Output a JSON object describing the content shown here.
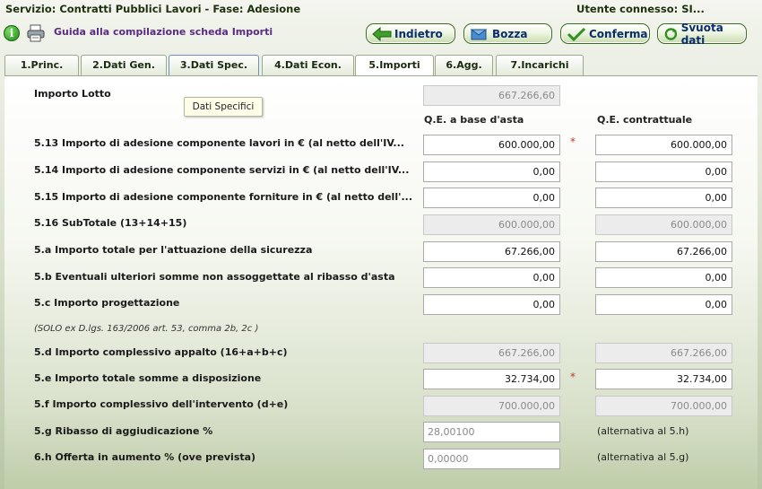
{
  "header": {
    "service": "Servizio: Contratti Pubblici Lavori - Fase: Adesione",
    "user": "Utente connesso: SI..."
  },
  "toolbar": {
    "guide": "Guida alla compilazione scheda Importi",
    "back": "Indietro",
    "draft": "Bozza",
    "confirm": "Conferma",
    "clear": "Svuota dati"
  },
  "tabs": [
    "1.Princ.",
    "2.Dati Gen.",
    "3.Dati Spec.",
    "4.Dati Econ.",
    "5.Importi",
    "6.Agg.",
    "7.Incarichi"
  ],
  "active_tab": "5.Importi",
  "tooltip": "Dati Specifici",
  "columns": {
    "base": "Q.E. a base d'asta",
    "contract": "Q.E. contrattuale"
  },
  "lotto": {
    "label": "Importo Lotto",
    "value": "667.266,60"
  },
  "rows": [
    {
      "label": "5.13 Importo di adesione componente lavori in € (al netto dell'IV...",
      "base": "600.000,00",
      "contract": "600.000,00",
      "required": "*"
    },
    {
      "label": "5.14 Importo di adesione componente servizi in € (al netto dell'IV...",
      "base": "0,00",
      "contract": "0,00"
    },
    {
      "label": "5.15 Importo di adesione componente forniture in € (al netto dell'...",
      "base": "0,00",
      "contract": "0,00"
    },
    {
      "label": "5.16 SubTotale (13+14+15)",
      "base": "600.000,00",
      "contract": "600.000,00"
    },
    {
      "label": "5.a Importo totale per l'attuazione della sicurezza",
      "base": "67.266,00",
      "contract": "67.266,00"
    },
    {
      "label": "5.b Eventuali ulteriori somme non assoggettate al ribasso d'asta",
      "base": "0,00",
      "contract": "0,00"
    },
    {
      "label": "5.c Importo progettazione",
      "base": "0,00",
      "contract": "0,00"
    },
    {
      "label": "5.d Importo complessivo appalto (16+a+b+c)",
      "base": "667.266,00",
      "contract": "667.266,00"
    },
    {
      "label": "5.e Importo totale somme a disposizione",
      "base": "32.734,00",
      "contract": "32.734,00",
      "required": "*"
    },
    {
      "label": "5.f Importo complessivo dell'intervento (d+e)",
      "base": "700.000,00",
      "contract": "700.000,00"
    }
  ],
  "note": "(SOLO ex D.lgs. 163/2006 art. 53, comma 2b, 2c )",
  "ribasso": {
    "label": "5.g Ribasso di aggiudicazione %",
    "value": "28,00100",
    "alt": "(alternativa al 5.h)"
  },
  "offerta": {
    "label": "6.h Offerta in aumento % (ove prevista)",
    "value": "0,00000",
    "alt": "(alternativa al 5.g)"
  },
  "colors": {
    "accent": "#3d6b22",
    "link": "#5a2a84",
    "required": "#c0392b"
  }
}
